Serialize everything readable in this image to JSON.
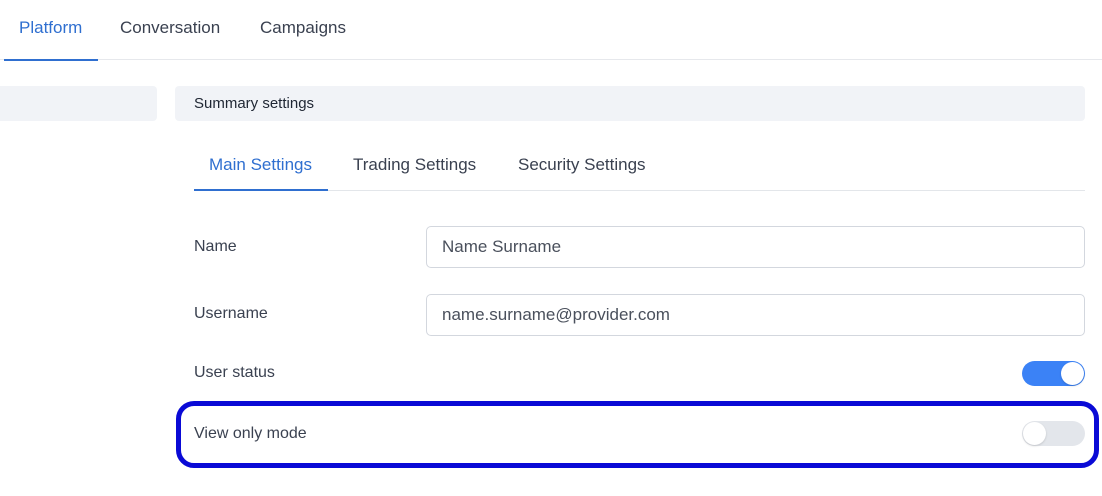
{
  "top_nav": {
    "tabs": [
      {
        "label": "Platform",
        "active": true
      },
      {
        "label": "Conversation",
        "active": false
      },
      {
        "label": "Campaigns",
        "active": false
      }
    ]
  },
  "section": {
    "title": "Summary settings"
  },
  "sub_tabs": [
    {
      "label": "Main Settings",
      "active": true
    },
    {
      "label": "Trading Settings",
      "active": false
    },
    {
      "label": "Security Settings",
      "active": false
    }
  ],
  "form": {
    "name": {
      "label": "Name",
      "value": "Name Surname"
    },
    "username": {
      "label": "Username",
      "value": "name.surname@provider.com"
    },
    "user_status": {
      "label": "User status",
      "enabled": true
    },
    "view_only_mode": {
      "label": "View only mode",
      "enabled": false
    }
  },
  "colors": {
    "accent": "#2f6fd0",
    "toggle_on": "#3b82f6",
    "toggle_off": "#e3e6eb",
    "highlight": "#0a0ad6"
  }
}
